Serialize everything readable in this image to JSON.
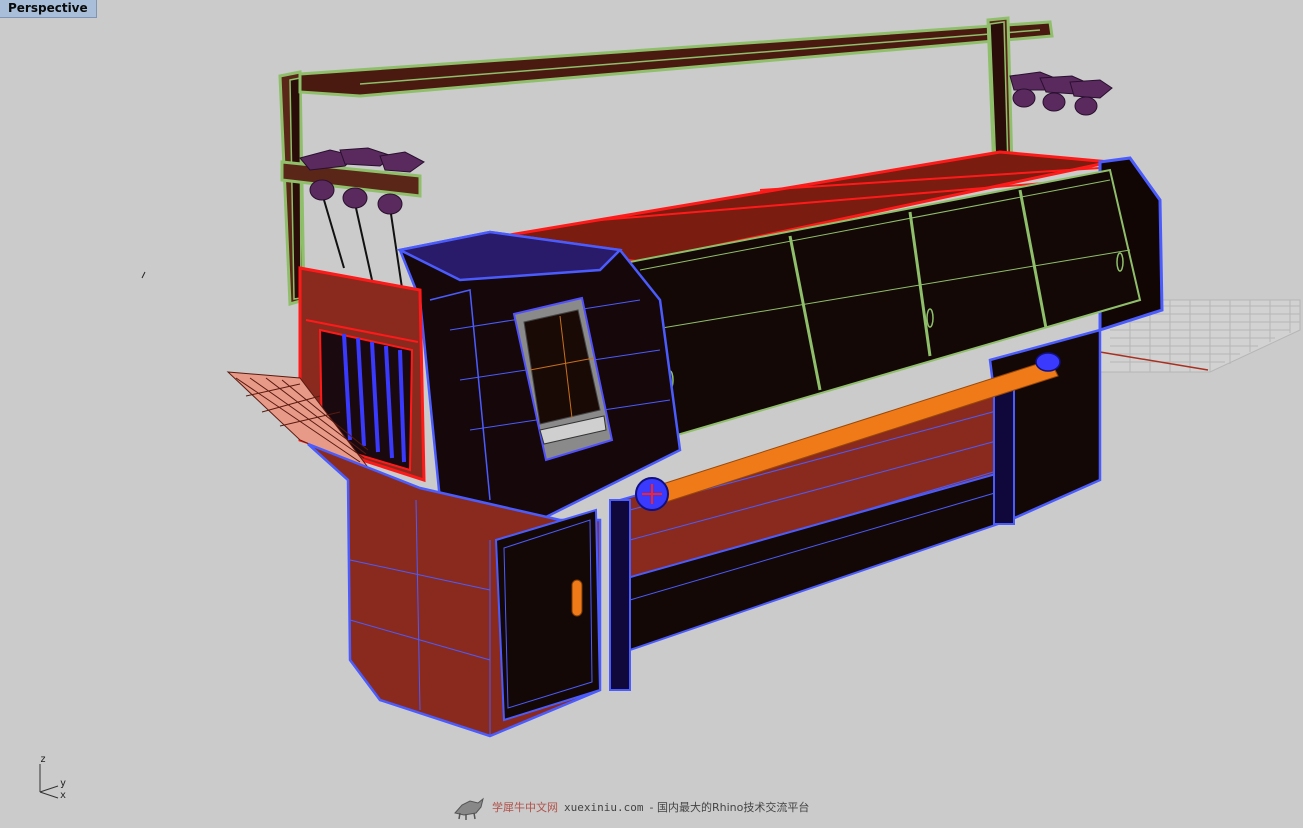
{
  "viewport": {
    "tab_label": "Perspective"
  },
  "axes": {
    "z": "z",
    "y": "y",
    "x": "x"
  },
  "watermark": {
    "brand": "学犀牛中文网",
    "domain": "xuexiniu.com",
    "slogan": "- 国内最大的Rhino技术交流平台"
  },
  "colors": {
    "background": "#cbcbcb",
    "frame_red": "#8a2a1e",
    "body_dark": "#1c0b08",
    "selected_blue": "#4b5cff",
    "selected_red": "#ff1a1a",
    "selected_green": "#8fbf6a",
    "rod_orange": "#f07a18",
    "grid": "#b8b8b8"
  },
  "icons": {
    "logo": "rhino-logo-icon"
  }
}
